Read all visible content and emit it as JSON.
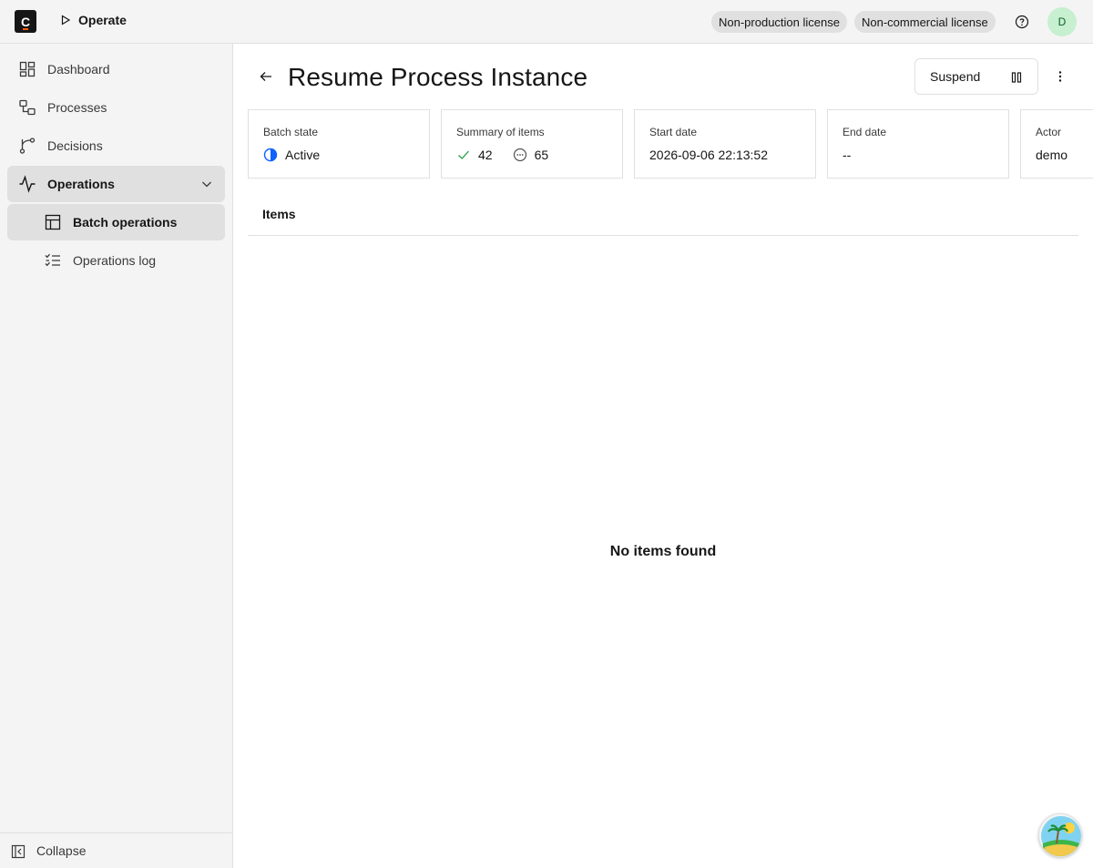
{
  "header": {
    "logo_letter": "C",
    "app_name": "Operate",
    "tags": [
      "Non-production license",
      "Non-commercial license"
    ],
    "avatar_initial": "D",
    "icons": {
      "help": "help-circle-icon",
      "app": "play-icon"
    }
  },
  "sidebar": {
    "items": [
      {
        "label": "Dashboard",
        "icon": "dashboard-icon"
      },
      {
        "label": "Processes",
        "icon": "process-icon"
      },
      {
        "label": "Decisions",
        "icon": "decision-icon"
      },
      {
        "label": "Operations",
        "icon": "activity-icon",
        "expanded": true
      },
      {
        "label": "Batch operations",
        "icon": "table-icon",
        "active": true
      },
      {
        "label": "Operations log",
        "icon": "checklist-icon"
      }
    ],
    "collapse_label": "Collapse"
  },
  "page": {
    "title": "Resume Process Instance",
    "suspend_label": "Suspend"
  },
  "tiles": {
    "batch_state": {
      "label": "Batch state",
      "value": "Active"
    },
    "summary": {
      "label": "Summary of items",
      "success_count": "42",
      "pending_count": "65"
    },
    "start_date": {
      "label": "Start date",
      "value": "2026-09-06 22:13:52"
    },
    "end_date": {
      "label": "End date",
      "value": "--"
    },
    "actor": {
      "label": "Actor",
      "value": "demo"
    }
  },
  "items": {
    "heading": "Items",
    "empty_message": "No items found"
  },
  "colors": {
    "accent_blue": "#0f62fe",
    "success_green": "#24a148",
    "avatar_bg": "#c6f0d0",
    "logo_accent": "#fc5d0d"
  }
}
